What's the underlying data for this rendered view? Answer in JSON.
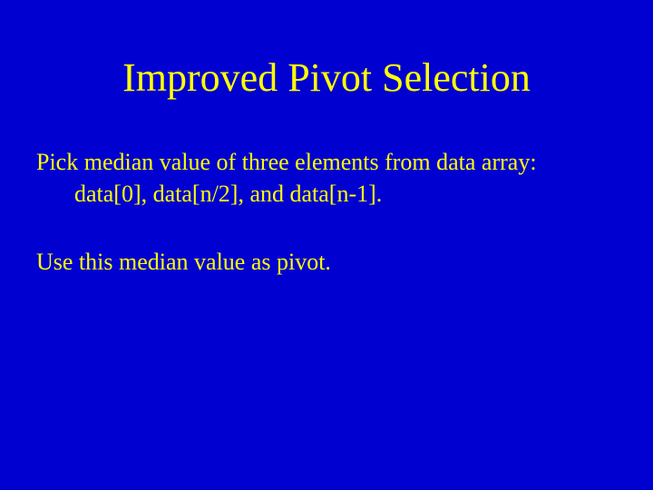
{
  "slide": {
    "title": "Improved Pivot Selection",
    "p1_line1": "Pick median value of three elements from data array:",
    "p1_line2": "data[0], data[n/2], and data[n-1].",
    "p2": "Use this median value as pivot."
  }
}
